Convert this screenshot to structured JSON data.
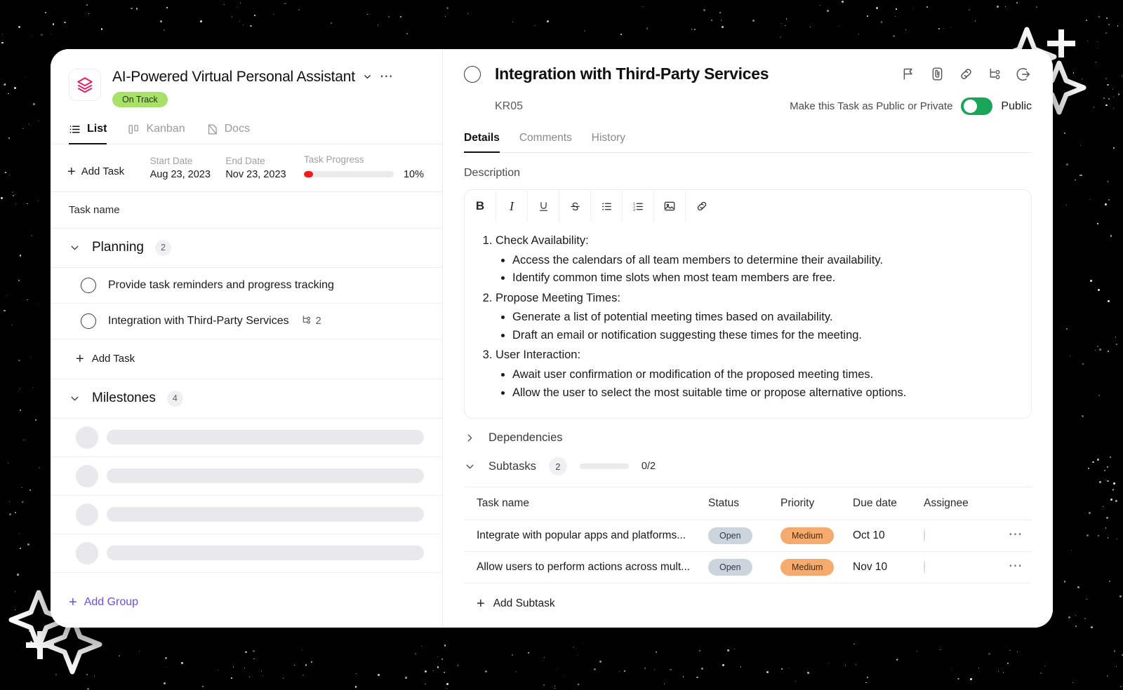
{
  "left": {
    "project": {
      "logo_icon": "layers-icon",
      "title": "AI-Powered Virtual Personal Assistant",
      "chevron_icon": "chevron-down-icon",
      "more_icon": "ellipsis-horizontal-icon",
      "status_badge": "On Track",
      "status_color": "#a8e06a"
    },
    "view_tabs": [
      {
        "label": "List",
        "icon": "list-icon",
        "active": true
      },
      {
        "label": "Kanban",
        "icon": "kanban-icon",
        "active": false
      },
      {
        "label": "Docs",
        "icon": "document-icon",
        "active": false
      }
    ],
    "meta": {
      "add_task_label": "Add Task",
      "start_date_label": "Start Date",
      "start_date_value": "Aug 23, 2023",
      "end_date_label": "End Date",
      "end_date_value": "Nov 23, 2023",
      "progress_label": "Task Progress",
      "progress_percent_text": "10%",
      "progress_percent": 10,
      "progress_color": "#f01c1c"
    },
    "column_header": "Task name",
    "groups": [
      {
        "name": "Planning",
        "count": "2",
        "tasks": [
          {
            "name": "Provide task reminders and progress tracking",
            "subtask_count": ""
          },
          {
            "name": "Integration with Third-Party Services",
            "subtask_count": "2"
          }
        ],
        "add_task_label": "Add Task"
      },
      {
        "name": "Milestones",
        "count": "4",
        "skeleton_rows": 4
      }
    ],
    "add_group_label": "Add Group"
  },
  "right": {
    "task": {
      "title": "Integration with Third-Party Services",
      "code": "KR05"
    },
    "head_icons": [
      "flag-icon",
      "attachment-icon",
      "link-icon",
      "subtask-tree-icon",
      "open-in-new-icon"
    ],
    "privacy": {
      "label": "Make this Task as Public or Private",
      "state": "Public",
      "enabled": true,
      "toggle_color": "#18a558"
    },
    "tabs": [
      {
        "label": "Details",
        "active": true
      },
      {
        "label": "Comments",
        "active": false
      },
      {
        "label": "History",
        "active": false
      }
    ],
    "description": {
      "section_label": "Description",
      "toolbar": [
        {
          "icon": "bold-icon",
          "glyph": "B"
        },
        {
          "icon": "italic-icon",
          "glyph": "I"
        },
        {
          "icon": "underline-icon",
          "glyph": "U"
        },
        {
          "icon": "strikethrough-icon",
          "glyph": "S"
        },
        {
          "icon": "bullet-list-icon",
          "glyph": ""
        },
        {
          "icon": "numbered-list-icon",
          "glyph": ""
        },
        {
          "icon": "image-icon",
          "glyph": ""
        },
        {
          "icon": "link-icon",
          "glyph": ""
        }
      ],
      "items": [
        {
          "title": "Check Availability:",
          "bullets": [
            "Access the calendars of all team members to determine their availability.",
            "Identify common time slots when most team members are free."
          ]
        },
        {
          "title": "Propose Meeting Times:",
          "bullets": [
            "Generate a list of potential meeting times based on availability.",
            "Draft an email or notification suggesting these times for the meeting."
          ]
        },
        {
          "title": "User Interaction:",
          "bullets": [
            "Await user confirmation or modification of the proposed meeting times.",
            "Allow the user to select the most suitable time or propose alternative options."
          ]
        }
      ]
    },
    "dependencies": {
      "label": "Dependencies",
      "expanded": false
    },
    "subtasks": {
      "label": "Subtasks",
      "count": "2",
      "ratio": "0/2",
      "progress_percent": 0,
      "expanded": true,
      "columns": [
        "Task name",
        "Status",
        "Priority",
        "Due date",
        "Assignee"
      ],
      "rows": [
        {
          "name": "Integrate with popular apps and platforms...",
          "status": "Open",
          "priority": "Medium",
          "due_date": "Oct 10",
          "assignee": "avatar",
          "more_icon": "ellipsis-horizontal-icon"
        },
        {
          "name": "Allow users to perform actions across mult...",
          "status": "Open",
          "priority": "Medium",
          "due_date": "Nov 10",
          "assignee": "avatar",
          "more_icon": "ellipsis-horizontal-icon"
        }
      ],
      "status_color": "#ccd4dd",
      "priority_color": "#f5ab6d",
      "add_subtask_label": "Add Subtask"
    }
  }
}
